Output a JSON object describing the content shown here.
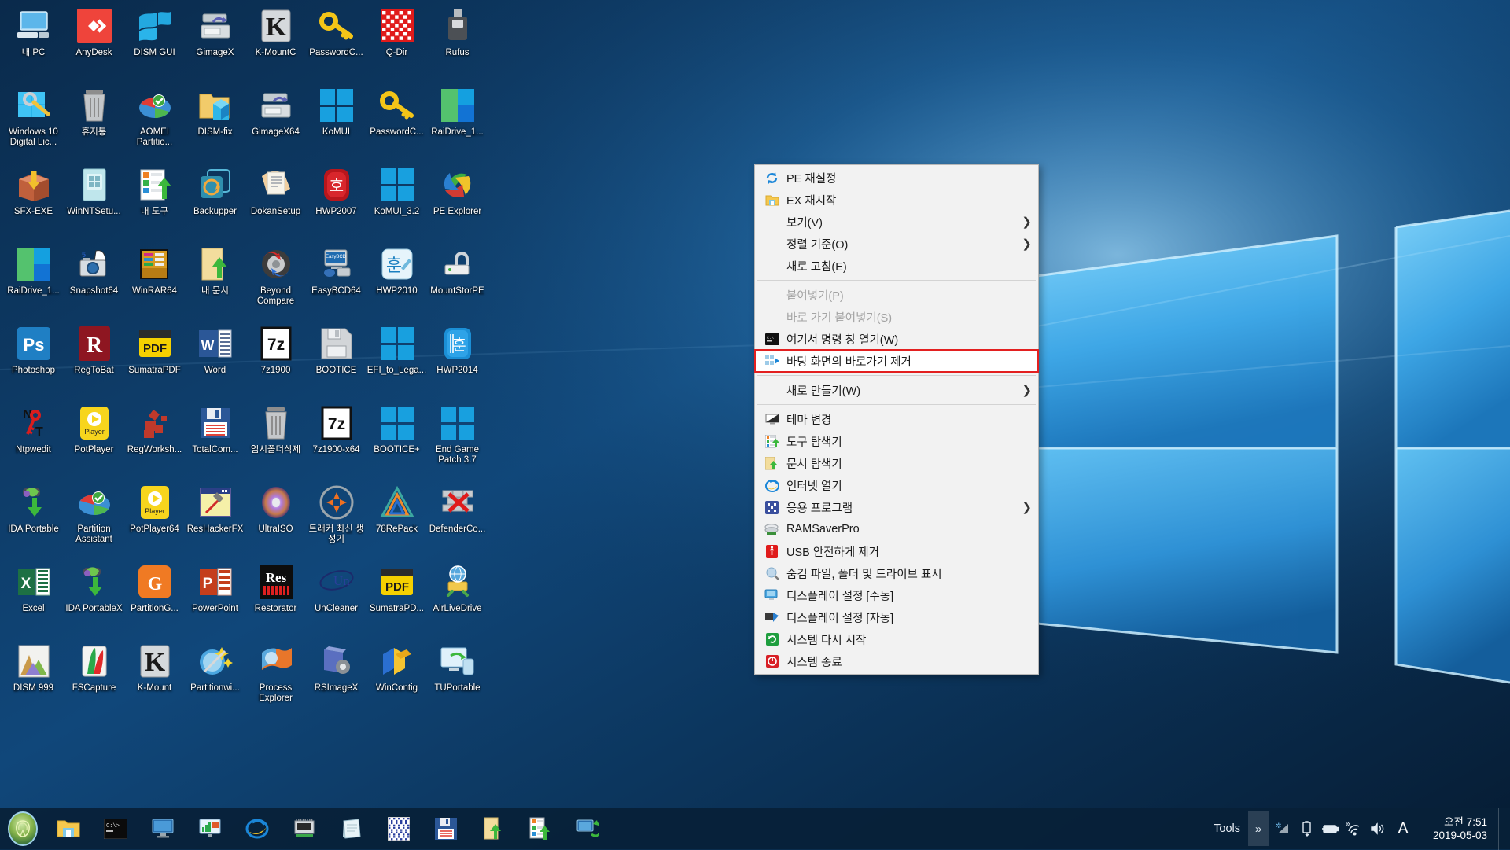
{
  "desktop": {
    "icons": [
      {
        "label": "내 PC",
        "icon": "this-pc-icon",
        "kind": "monitor"
      },
      {
        "label": "AnyDesk",
        "icon": "anydesk-icon",
        "kind": "anydesk"
      },
      {
        "label": "DISM GUI",
        "icon": "dism-gui-icon",
        "kind": "winflag"
      },
      {
        "label": "GimageX",
        "icon": "gimagex-icon",
        "kind": "drive"
      },
      {
        "label": "K-MountC",
        "icon": "k-mountc-icon",
        "kind": "kletter"
      },
      {
        "label": "PasswordC...",
        "icon": "password-changer-icon",
        "kind": "key"
      },
      {
        "label": "Q-Dir",
        "icon": "q-dir-icon",
        "kind": "qdir"
      },
      {
        "label": "Rufus",
        "icon": "rufus-icon",
        "kind": "usb"
      },
      {
        "label": "Windows 10 Digital Lic...",
        "icon": "windows-digital-license-icon",
        "kind": "winkey"
      },
      {
        "label": "휴지통",
        "icon": "recycle-bin-icon",
        "kind": "bin"
      },
      {
        "label": "AOMEI Partitio...",
        "icon": "aomei-partition-icon",
        "kind": "pie"
      },
      {
        "label": "DISM-fix",
        "icon": "dism-fix-icon",
        "kind": "foldercube"
      },
      {
        "label": "GimageX64",
        "icon": "gimagex64-icon",
        "kind": "drive"
      },
      {
        "label": "KoMUI",
        "icon": "komui-icon",
        "kind": "win4"
      },
      {
        "label": "PasswordC...",
        "icon": "password-changer-2-icon",
        "kind": "key"
      },
      {
        "label": "RaiDrive_1...",
        "icon": "raidrive-icon",
        "kind": "raidrive"
      },
      {
        "label": "SFX-EXE",
        "icon": "sfx-exe-icon",
        "kind": "box"
      },
      {
        "label": "WinNTSetu...",
        "icon": "winntsetup-icon",
        "kind": "winntsetup"
      },
      {
        "label": "내 도구",
        "icon": "my-tools-icon",
        "kind": "toolsup"
      },
      {
        "label": "Backupper",
        "icon": "backupper-icon",
        "kind": "backupper"
      },
      {
        "label": "DokanSetup",
        "icon": "dokan-setup-icon",
        "kind": "doc"
      },
      {
        "label": "HWP2007",
        "icon": "hwp2007-icon",
        "kind": "hwp"
      },
      {
        "label": "KoMUI_3.2",
        "icon": "komui32-icon",
        "kind": "win4"
      },
      {
        "label": "PE Explorer",
        "icon": "pe-explorer-icon",
        "kind": "peexp"
      },
      {
        "label": "RaiDrive_1...",
        "icon": "raidrive2-icon",
        "kind": "raidrive"
      },
      {
        "label": "Snapshot64",
        "icon": "snapshot64-icon",
        "kind": "snapshot"
      },
      {
        "label": "WinRAR64",
        "icon": "winrar64-icon",
        "kind": "winrar"
      },
      {
        "label": "내 문서",
        "icon": "my-documents-icon",
        "kind": "docup"
      },
      {
        "label": "Beyond Compare",
        "icon": "beyond-compare-icon",
        "kind": "beyond"
      },
      {
        "label": "EasyBCD64",
        "icon": "easybcd64-icon",
        "kind": "easybcd"
      },
      {
        "label": "HWP2010",
        "icon": "hwp2010-icon",
        "kind": "hwp2010"
      },
      {
        "label": "MountStorPE",
        "icon": "mountstorpe-icon",
        "kind": "mountstor"
      },
      {
        "label": "Photoshop",
        "icon": "photoshop-icon",
        "kind": "ps"
      },
      {
        "label": "RegToBat",
        "icon": "regtobat-icon",
        "kind": "rlogo"
      },
      {
        "label": "SumatraPDF",
        "icon": "sumatrapdf-icon",
        "kind": "pdf"
      },
      {
        "label": "Word",
        "icon": "word-icon",
        "kind": "word"
      },
      {
        "label": "7z1900",
        "icon": "7zip-icon",
        "kind": "sevenz"
      },
      {
        "label": "BOOTICE",
        "icon": "bootice-icon",
        "kind": "floppygray"
      },
      {
        "label": "EFI_to_Lega...",
        "icon": "efi-to-legacy-icon",
        "kind": "win4"
      },
      {
        "label": "HWP2014",
        "icon": "hwp2014-icon",
        "kind": "hwp2014"
      },
      {
        "label": "Ntpwedit",
        "icon": "ntpwedit-icon",
        "kind": "ntpw"
      },
      {
        "label": "PotPlayer",
        "icon": "potplayer-icon",
        "kind": "pot"
      },
      {
        "label": "RegWorksh...",
        "icon": "regworkshop-icon",
        "kind": "regws"
      },
      {
        "label": "TotalCom...",
        "icon": "total-commander-icon",
        "kind": "floppyblue"
      },
      {
        "label": "임시폴더삭제",
        "icon": "temp-folder-delete-icon",
        "kind": "bin"
      },
      {
        "label": "7z1900-x64",
        "icon": "7zip-x64-icon",
        "kind": "sevenz"
      },
      {
        "label": "BOOTICE+",
        "icon": "bootice-plus-icon",
        "kind": "win4"
      },
      {
        "label": "End Game Patch 3.7",
        "icon": "end-game-patch-icon",
        "kind": "win4"
      },
      {
        "label": "IDA Portable",
        "icon": "ida-portable-icon",
        "kind": "idahand"
      },
      {
        "label": "Partition Assistant",
        "icon": "partition-assistant-icon",
        "kind": "pie"
      },
      {
        "label": "PotPlayer64",
        "icon": "potplayer64-icon",
        "kind": "pot"
      },
      {
        "label": "ResHackerFX",
        "icon": "reshackerfx-icon",
        "kind": "reshack"
      },
      {
        "label": "UltraISO",
        "icon": "ultraiso-icon",
        "kind": "disc"
      },
      {
        "label": "트래커 최신 생성기",
        "icon": "tracker-generator-icon",
        "kind": "tracker"
      },
      {
        "label": "78RePack",
        "icon": "78repack-icon",
        "kind": "tri"
      },
      {
        "label": "DefenderCo...",
        "icon": "defender-control-icon",
        "kind": "wallx"
      },
      {
        "label": "Excel",
        "icon": "excel-icon",
        "kind": "excel"
      },
      {
        "label": "IDA PortableX",
        "icon": "ida-portablex-icon",
        "kind": "idahand"
      },
      {
        "label": "PartitionG...",
        "icon": "partition-guru-icon",
        "kind": "pguru"
      },
      {
        "label": "PowerPoint",
        "icon": "powerpoint-icon",
        "kind": "ppt"
      },
      {
        "label": "Restorator",
        "icon": "restorator-icon",
        "kind": "restor"
      },
      {
        "label": "UnCleaner",
        "icon": "uncleaner-icon",
        "kind": "uncleaner"
      },
      {
        "label": "SumatraPD...",
        "icon": "sumatrapdf2-icon",
        "kind": "pdf"
      },
      {
        "label": "AirLiveDrive",
        "icon": "airlivedrive-icon",
        "kind": "airlive"
      },
      {
        "label": "DISM 999",
        "icon": "dism-999-icon",
        "kind": "mountains"
      },
      {
        "label": "FSCapture",
        "icon": "fscapture-icon",
        "kind": "fscap"
      },
      {
        "label": "K-Mount",
        "icon": "k-mount-icon",
        "kind": "kletter"
      },
      {
        "label": "Partitionwi...",
        "icon": "partition-wizard-icon",
        "kind": "pwiz"
      },
      {
        "label": "Process Explorer",
        "icon": "process-explorer-icon",
        "kind": "procexp"
      },
      {
        "label": "RSImageX",
        "icon": "rsimagex-icon",
        "kind": "rsimage"
      },
      {
        "label": "WinContig",
        "icon": "wincontig-icon",
        "kind": "contig"
      },
      {
        "label": "TUPortable",
        "icon": "tuportable-icon",
        "kind": "tuport"
      }
    ]
  },
  "context_menu": {
    "items": [
      {
        "type": "item",
        "label": "PE 재설정",
        "icon": "refresh-blue-icon",
        "submenu": false,
        "disabled": false,
        "highlighted": false
      },
      {
        "type": "item",
        "label": "EX 재시작",
        "icon": "folder-restart-icon",
        "submenu": false,
        "disabled": false,
        "highlighted": false
      },
      {
        "type": "item",
        "label": "보기(V)",
        "icon": "none",
        "submenu": true,
        "disabled": false,
        "highlighted": false
      },
      {
        "type": "item",
        "label": "정렬 기준(O)",
        "icon": "none",
        "submenu": true,
        "disabled": false,
        "highlighted": false
      },
      {
        "type": "item",
        "label": "새로 고침(E)",
        "icon": "none",
        "submenu": false,
        "disabled": false,
        "highlighted": false
      },
      {
        "type": "separator"
      },
      {
        "type": "item",
        "label": "붙여넣기(P)",
        "icon": "none",
        "submenu": false,
        "disabled": true,
        "highlighted": false
      },
      {
        "type": "item",
        "label": "바로 가기 붙여넣기(S)",
        "icon": "none",
        "submenu": false,
        "disabled": true,
        "highlighted": false
      },
      {
        "type": "item",
        "label": "여기서 명령 창 열기(W)",
        "icon": "console-icon",
        "submenu": false,
        "disabled": false,
        "highlighted": false
      },
      {
        "type": "item",
        "label": "바탕 화면의 바로가기 제거",
        "icon": "remove-shortcut-icon",
        "submenu": false,
        "disabled": false,
        "highlighted": true
      },
      {
        "type": "separator"
      },
      {
        "type": "item",
        "label": "새로 만들기(W)",
        "icon": "none",
        "submenu": true,
        "disabled": false,
        "highlighted": false
      },
      {
        "type": "separator"
      },
      {
        "type": "item",
        "label": "테마 변경",
        "icon": "theme-monitor-icon",
        "submenu": false,
        "disabled": false,
        "highlighted": false
      },
      {
        "type": "item",
        "label": "도구 탐색기",
        "icon": "tools-explorer-icon",
        "submenu": false,
        "disabled": false,
        "highlighted": false
      },
      {
        "type": "item",
        "label": "문서 탐색기",
        "icon": "documents-explorer-icon",
        "submenu": false,
        "disabled": false,
        "highlighted": false
      },
      {
        "type": "item",
        "label": "인터넷 열기",
        "icon": "internet-explorer-icon",
        "submenu": false,
        "disabled": false,
        "highlighted": false
      },
      {
        "type": "item",
        "label": "응용 프로그램",
        "icon": "applications-icon",
        "submenu": true,
        "disabled": false,
        "highlighted": false
      },
      {
        "type": "item",
        "label": "RAMSaverPro",
        "icon": "ramsaver-icon",
        "submenu": false,
        "disabled": false,
        "highlighted": false
      },
      {
        "type": "item",
        "label": "USB 안전하게 제거",
        "icon": "usb-eject-icon",
        "submenu": false,
        "disabled": false,
        "highlighted": false
      },
      {
        "type": "item",
        "label": "숨김 파일, 폴더 및 드라이브 표시",
        "icon": "show-hidden-files-icon",
        "submenu": false,
        "disabled": false,
        "highlighted": false
      },
      {
        "type": "item",
        "label": "디스플레이 설정 [수동]",
        "icon": "display-settings-manual-icon",
        "submenu": false,
        "disabled": false,
        "highlighted": false
      },
      {
        "type": "item",
        "label": "디스플레이 설정 [자동]",
        "icon": "display-settings-auto-icon",
        "submenu": false,
        "disabled": false,
        "highlighted": false
      },
      {
        "type": "item",
        "label": "시스템 다시 시작",
        "icon": "system-restart-icon",
        "submenu": false,
        "disabled": false,
        "highlighted": false
      },
      {
        "type": "item",
        "label": "시스템 종료",
        "icon": "system-shutdown-icon",
        "submenu": false,
        "disabled": false,
        "highlighted": false
      }
    ],
    "highlight_color": "#e32020"
  },
  "taskbar": {
    "start_button": "start-orb-icon",
    "pinned": [
      {
        "icon": "folder-explorer-icon",
        "name": "file-explorer"
      },
      {
        "icon": "command-prompt-icon",
        "name": "command-prompt"
      },
      {
        "icon": "monitor-blue-icon",
        "name": "display-tool"
      },
      {
        "icon": "chart-monitor-icon",
        "name": "system-monitor"
      },
      {
        "icon": "internet-explorer-icon",
        "name": "internet-explorer"
      },
      {
        "icon": "chip-icon",
        "name": "hardware-info"
      },
      {
        "icon": "notepad-icon",
        "name": "notepad"
      },
      {
        "icon": "qdir-grid-icon",
        "name": "q-dir"
      },
      {
        "icon": "floppy-save-icon",
        "name": "total-commander"
      },
      {
        "icon": "documents-up-icon",
        "name": "my-documents"
      },
      {
        "icon": "tools-up-icon",
        "name": "my-tools"
      },
      {
        "icon": "recovery-icon",
        "name": "recovery-tool"
      }
    ],
    "tools_label": "Tools",
    "overflow_icon": "chevron-right-double-icon",
    "tray": [
      {
        "icon": "network-signal-icon",
        "name": "network-status"
      },
      {
        "icon": "usb-safely-remove-icon",
        "name": "safely-remove-hardware"
      },
      {
        "icon": "battery-icon",
        "name": "battery"
      },
      {
        "icon": "wifi-icon",
        "name": "wifi"
      },
      {
        "icon": "volume-icon",
        "name": "volume"
      }
    ],
    "ime": "A",
    "clock": {
      "time": "오전 7:51",
      "date": "2019-05-03"
    }
  }
}
